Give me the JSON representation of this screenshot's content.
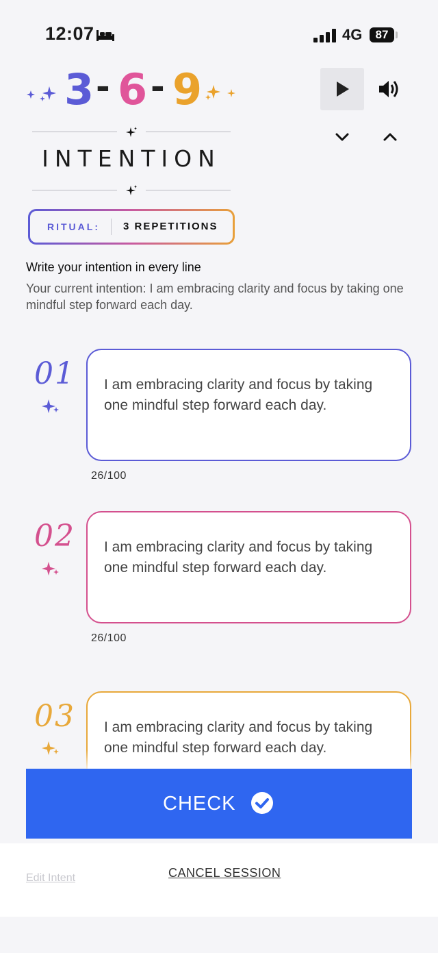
{
  "status_bar": {
    "time": "12:07",
    "network": "4G",
    "battery": "87"
  },
  "logo": {
    "d1": "3",
    "d2": "6",
    "d3": "9",
    "sep": "-",
    "colors": {
      "d1": "#5b5bd6",
      "d2": "#e0559a",
      "d3": "#eaa22c"
    }
  },
  "header": {
    "title": "INTENTION"
  },
  "ritual": {
    "label": "RITUAL:",
    "value": "3 REPETITIONS"
  },
  "instructions": {
    "title": "Write your intention in every line",
    "current": "Your current intention: I am embracing clarity and focus by taking one mindful step forward each day."
  },
  "lines": [
    {
      "number": "01",
      "text": "I am embracing clarity and focus by taking one mindful step forward each day.",
      "counter": "26/100",
      "color": "#5b5bd6"
    },
    {
      "number": "02",
      "text": "I am embracing clarity and focus by taking one mindful step forward each day.",
      "counter": "26/100",
      "color": "#d4508e"
    },
    {
      "number": "03",
      "text": "I am embracing clarity and focus by taking one mindful step forward each day.",
      "counter": "",
      "color": "#e8a83a"
    }
  ],
  "actions": {
    "check": "CHECK",
    "cancel": "CANCEL SESSION",
    "edit": "Edit Intent"
  },
  "icons": [
    "bed-icon",
    "signal-icon",
    "play-icon",
    "volume-icon",
    "chevron-down-icon",
    "chevron-up-icon",
    "sparkle-icon",
    "check-circle-icon"
  ]
}
